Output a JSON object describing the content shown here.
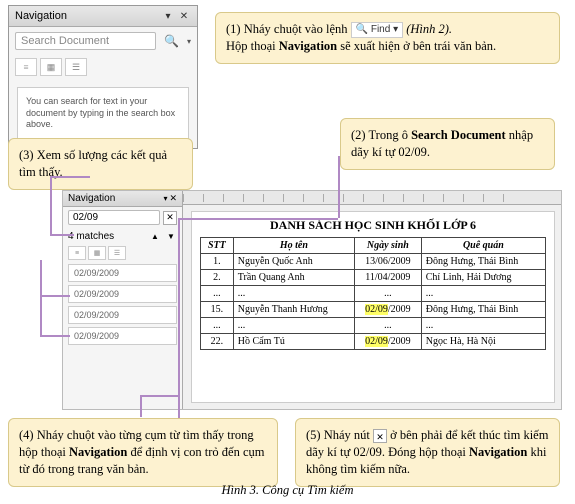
{
  "nav1": {
    "title": "Navigation",
    "search_placeholder": "Search Document",
    "hint": "You can search for text in your document by typing in the search box above."
  },
  "callouts": {
    "c1a": "(1) Nháy chuột vào lệnh ",
    "c1_find": "🔍 Find ▾",
    "c1b": " (Hình 2).",
    "c1c": "Hộp thoại ",
    "c1d": " sẽ xuất hiện ở bên trái văn bản.",
    "c1_bold": "Navigation",
    "c3": "(3) Xem số lượng các kết quả tìm thấy.",
    "c2a": "(2) Trong ô ",
    "c2_bold": "Search Document",
    "c2b": " nhập dãy kí tự 02/09.",
    "c4a": "(4) Nháy chuột vào từng cụm từ tìm thấy trong hộp thoại ",
    "c4_bold": "Navigation",
    "c4b": " để định vị con trỏ đến cụm từ đó trong trang văn bản.",
    "c5a": "(5) Nháy nút ",
    "c5_x": "✕",
    "c5b": " ở bên phải để kết thúc tìm kiếm dãy kí tự 02/09. Đóng hộp thoại ",
    "c5_bold": "Navigation",
    "c5c": " khi không tìm kiếm nữa."
  },
  "nav2": {
    "title": "Navigation",
    "search_value": "02/09",
    "matches": "4 matches",
    "results": [
      "02/09/2009",
      "02/09/2009",
      "02/09/2009",
      "02/09/2009"
    ]
  },
  "page": {
    "title": "DANH SÁCH HỌC SINH KHỐI LỚP 6",
    "headers": {
      "stt": "STT",
      "name": "Họ tên",
      "dob": "Ngày sinh",
      "home": "Quê quán"
    },
    "rows": [
      {
        "stt": "1.",
        "name": "Nguyễn Quốc Anh",
        "dob": "13/06/2009",
        "home": "Đông Hưng, Thái Bình"
      },
      {
        "stt": "2.",
        "name": "Trần Quang Anh",
        "dob": "11/04/2009",
        "home": "Chí Linh, Hải Dương"
      },
      {
        "stt": "...",
        "name": "...",
        "dob": "...",
        "home": "..."
      },
      {
        "stt": "15.",
        "name": "Nguyễn Thanh Hương",
        "dob_hl": "02/09",
        "dob_rest": "/2009",
        "home": "Đông Hưng, Thái Bình"
      },
      {
        "stt": "...",
        "name": "...",
        "dob": "...",
        "home": "..."
      },
      {
        "stt": "22.",
        "name": "Hồ Cẩm Tú",
        "dob_hl": "02/09",
        "dob_rest": "/2009",
        "home": "Ngọc Hà, Hà Nội"
      }
    ]
  },
  "caption": "Hình 3. Công cụ Tìm kiếm"
}
